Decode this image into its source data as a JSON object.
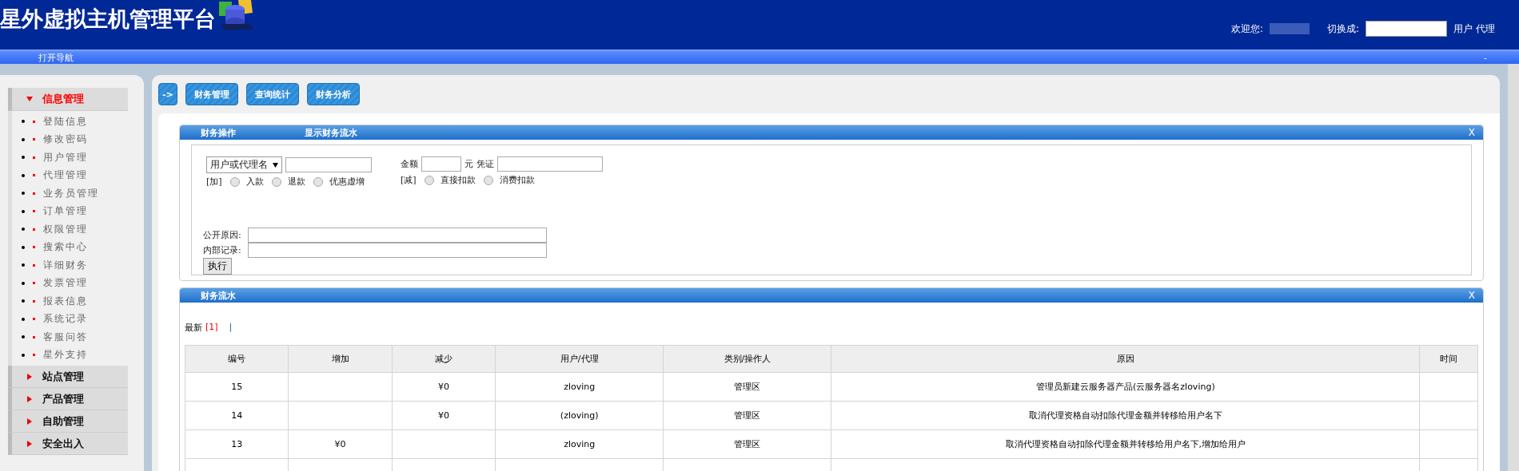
{
  "header": {
    "title": "星外虚拟主机管理平台",
    "welcome_label": "欢迎您:",
    "switch_label": "切换成:",
    "switch_links": [
      "用户",
      "代理"
    ]
  },
  "nav_bar": {
    "label": "打开导航",
    "collapse": "-"
  },
  "sidebar": {
    "groups": [
      {
        "label": "信息管理",
        "expanded": true,
        "items": [
          "登陆信息",
          "修改密码",
          "用户管理",
          "代理管理",
          "业务员管理",
          "订单管理",
          "权限管理",
          "搜索中心",
          "详细财务",
          "发票管理",
          "报表信息",
          "系统记录",
          "客服问答",
          "星外支持"
        ]
      },
      {
        "label": "站点管理",
        "expanded": false
      },
      {
        "label": "产品管理",
        "expanded": false
      },
      {
        "label": "自助管理",
        "expanded": false
      },
      {
        "label": "安全出入",
        "expanded": false
      }
    ]
  },
  "toolbar": {
    "toggle": "->",
    "buttons": [
      "财务管理",
      "查询统计",
      "财务分析"
    ]
  },
  "operation_card": {
    "tabs": [
      "财务操作",
      "显示财务流水"
    ],
    "close": "X",
    "select": {
      "value": "用户或代理名"
    },
    "amount_label": "金额",
    "currency_label": "元",
    "voucher_label": "凭证",
    "add_label": "[加]",
    "add_options": [
      {
        "label": "入款",
        "checked": false
      },
      {
        "label": "退款",
        "checked": false
      },
      {
        "label": "优惠虚增",
        "checked": false
      }
    ],
    "subtract_label": "[减]",
    "subtract_options": [
      {
        "label": "直接扣款",
        "checked": false
      },
      {
        "label": "消费扣款",
        "checked": false
      }
    ],
    "public_reason_label": "公开原因:",
    "internal_note_label": "内部记录:",
    "submit": "执行"
  },
  "flow_card": {
    "title": "财务流水",
    "close": "X",
    "pager": {
      "label": "最新",
      "page": "[1]",
      "separator": "|"
    },
    "columns": [
      "编号",
      "增加",
      "减少",
      "用户/代理",
      "类别/操作人",
      "原因",
      "时间"
    ],
    "rows": [
      {
        "id": "15",
        "increase": null,
        "decrease": "¥0",
        "user": "zloving",
        "category": "管理区",
        "reason": "管理员新建云服务器产品(云服务器名zloving)"
      },
      {
        "id": "14",
        "increase": null,
        "decrease": "¥0",
        "user": "(zloving)",
        "category": "管理区",
        "reason": "取消代理资格自动扣除代理金额并转移给用户名下"
      },
      {
        "id": "13",
        "increase": "¥0",
        "decrease": null,
        "user": "zloving",
        "category": "管理区",
        "reason": "取消代理资格自动扣除代理金额并转移给用户名下,增加给用户"
      }
    ]
  }
}
